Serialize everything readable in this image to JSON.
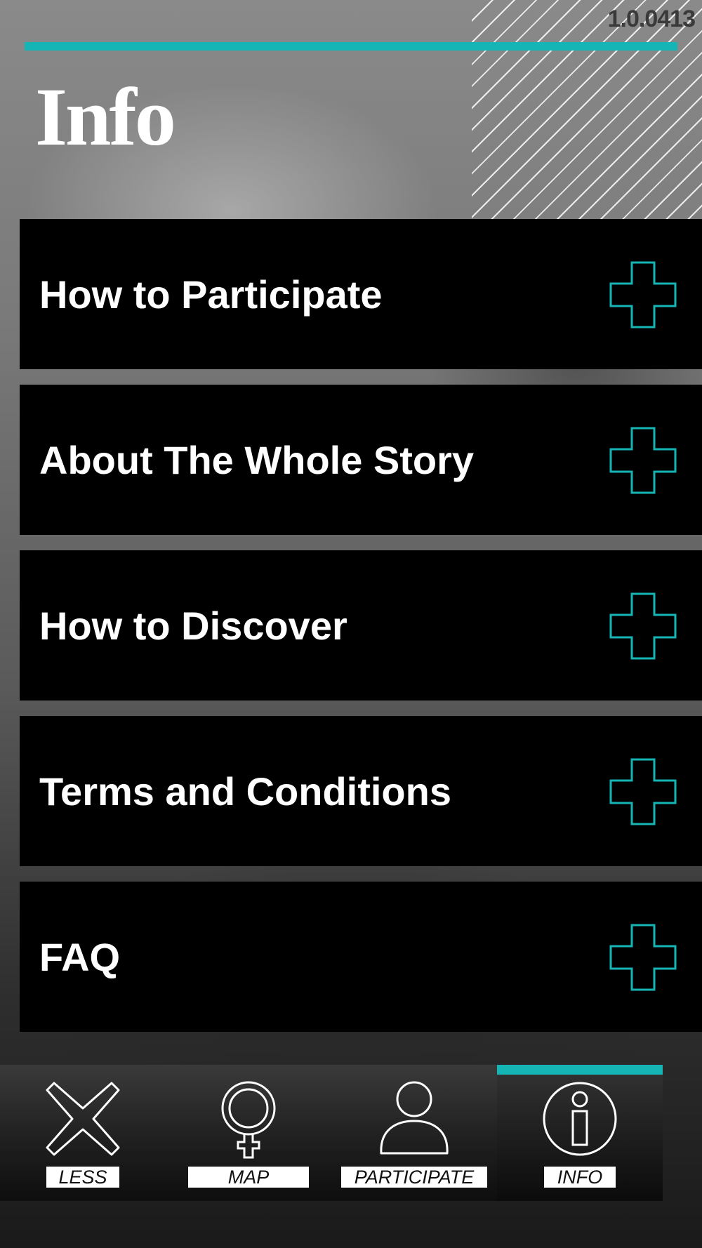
{
  "app": {
    "version": "1.0.0413",
    "title": "Info",
    "accent_color": "#16b5b5"
  },
  "menu": {
    "items": [
      {
        "label": "How to Participate",
        "icon": "plus-icon"
      },
      {
        "label": "About The Whole Story",
        "icon": "plus-icon"
      },
      {
        "label": "How to Discover",
        "icon": "plus-icon"
      },
      {
        "label": "Terms and Conditions",
        "icon": "plus-icon"
      },
      {
        "label": "FAQ",
        "icon": "plus-icon"
      }
    ]
  },
  "nav": {
    "items": [
      {
        "label": "LESS",
        "icon": "x-icon",
        "active": false
      },
      {
        "label": "MAP",
        "icon": "venus-symbol-icon",
        "active": false
      },
      {
        "label": "PARTICIPATE",
        "icon": "person-icon",
        "active": false
      },
      {
        "label": "INFO",
        "icon": "info-icon",
        "active": true
      }
    ]
  }
}
